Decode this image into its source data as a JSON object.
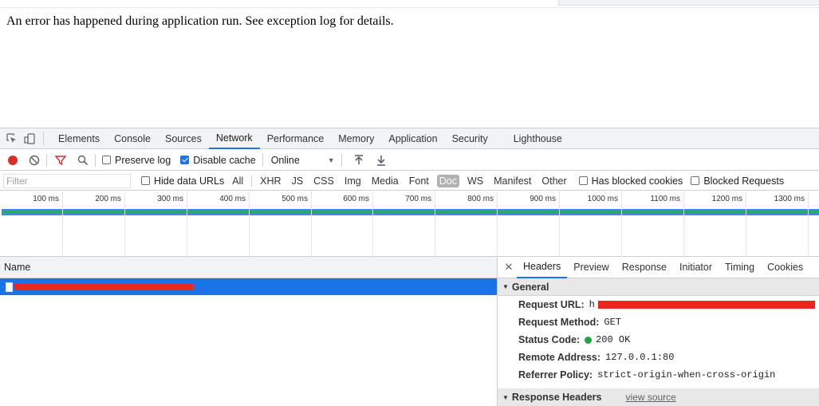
{
  "page": {
    "message": "An error has happened during application run. See exception log for details."
  },
  "devtools": {
    "tabs": [
      "Elements",
      "Console",
      "Sources",
      "Network",
      "Performance",
      "Memory",
      "Application",
      "Security",
      "Lighthouse"
    ],
    "active_tab": "Network",
    "toolbar": {
      "preserve_log": "Preserve log",
      "disable_cache": "Disable cache",
      "throttle": "Online"
    },
    "filter": {
      "placeholder": "Filter",
      "hide_data_urls": "Hide data URLs",
      "types": [
        "All",
        "XHR",
        "JS",
        "CSS",
        "Img",
        "Media",
        "Font",
        "Doc",
        "WS",
        "Manifest",
        "Other"
      ],
      "selected_type": "Doc",
      "has_blocked_cookies": "Has blocked cookies",
      "blocked_requests": "Blocked Requests"
    },
    "timeline_ticks": [
      "100 ms",
      "200 ms",
      "300 ms",
      "400 ms",
      "500 ms",
      "600 ms",
      "700 ms",
      "800 ms",
      "900 ms",
      "1000 ms",
      "1100 ms",
      "1200 ms",
      "1300 ms"
    ],
    "requests": {
      "column_name": "Name"
    },
    "detail": {
      "tabs": [
        "Headers",
        "Preview",
        "Response",
        "Initiator",
        "Timing",
        "Cookies"
      ],
      "active_tab": "Headers",
      "general_title": "General",
      "general": {
        "request_url_label": "Request URL:",
        "request_url_visible_char": "h",
        "request_method_label": "Request Method:",
        "request_method": "GET",
        "status_code_label": "Status Code:",
        "status_code": "200 OK",
        "remote_address_label": "Remote Address:",
        "remote_address": "127.0.0.1:80",
        "referrer_policy_label": "Referrer Policy:",
        "referrer_policy": "strict-origin-when-cross-origin"
      },
      "response_headers_title": "Response Headers",
      "view_source": "view source"
    },
    "colors": {
      "accent": "#1a73e8",
      "record": "#d93025",
      "status_ok": "#21a33e",
      "redaction": "#e8271d"
    }
  }
}
